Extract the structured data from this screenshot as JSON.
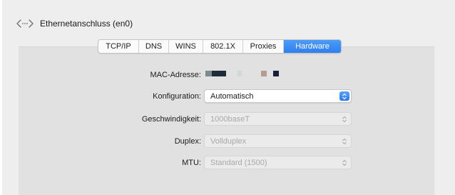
{
  "header": {
    "title": "Ethernetanschluss (en0)",
    "icon": "ethernet-arrows-icon"
  },
  "tabs": [
    {
      "label": "TCP/IP",
      "active": false
    },
    {
      "label": "DNS",
      "active": false
    },
    {
      "label": "WINS",
      "active": false
    },
    {
      "label": "802.1X",
      "active": false
    },
    {
      "label": "Proxies",
      "active": false
    },
    {
      "label": "Hardware",
      "active": true
    }
  ],
  "form": {
    "mac_label": "MAC-Adresse:",
    "konfiguration_label": "Konfiguration:",
    "konfiguration_value": "Automatisch",
    "geschwindigkeit_label": "Geschwindigkeit:",
    "geschwindigkeit_value": "1000baseT",
    "duplex_label": "Duplex:",
    "duplex_value": "Vollduplex",
    "mtu_label": "MTU:",
    "mtu_value": "Standard (1500)"
  },
  "colors": {
    "accent": "#2e7ef0",
    "panel": "#e1e1e1",
    "background": "#eeeeee"
  }
}
